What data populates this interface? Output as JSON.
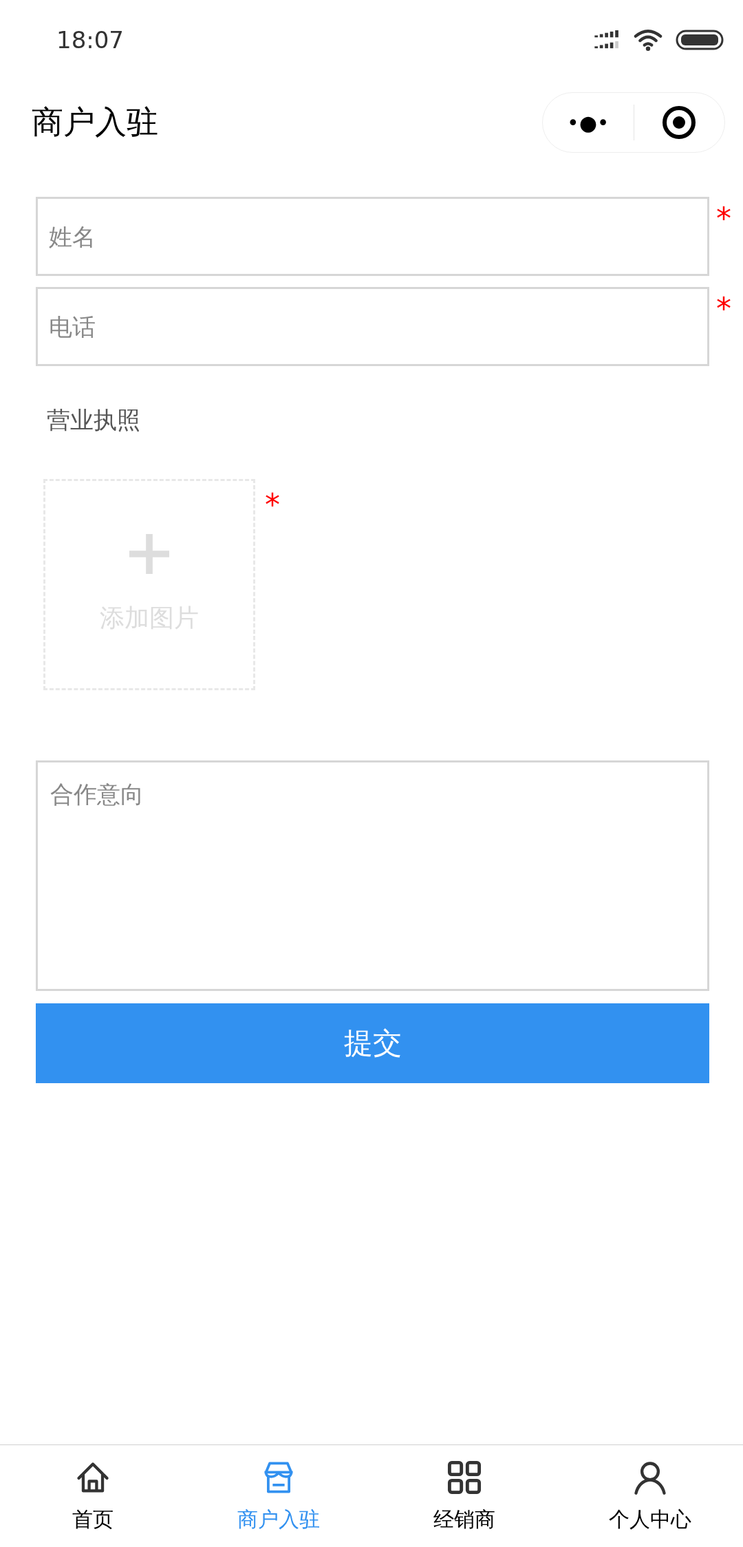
{
  "status_bar": {
    "time": "18:07"
  },
  "header": {
    "title": "商户入驻",
    "menu_glyph": "•●•"
  },
  "fields": [
    {
      "placeholder": "姓名",
      "required_mark": "*"
    },
    {
      "placeholder": "电话",
      "required_mark": "*"
    }
  ],
  "license": {
    "label": "营业执照",
    "upload_text": "添加图片",
    "required_mark": "*"
  },
  "intent": {
    "placeholder": "合作意向"
  },
  "submit": {
    "label": "提交"
  },
  "tabs": [
    {
      "label": "首页",
      "kind": "home",
      "selected": false
    },
    {
      "label": "商户入驻",
      "kind": "store",
      "selected": true
    },
    {
      "label": "经销商",
      "kind": "grid",
      "selected": false
    },
    {
      "label": "个人中心",
      "kind": "person",
      "selected": false
    }
  ]
}
